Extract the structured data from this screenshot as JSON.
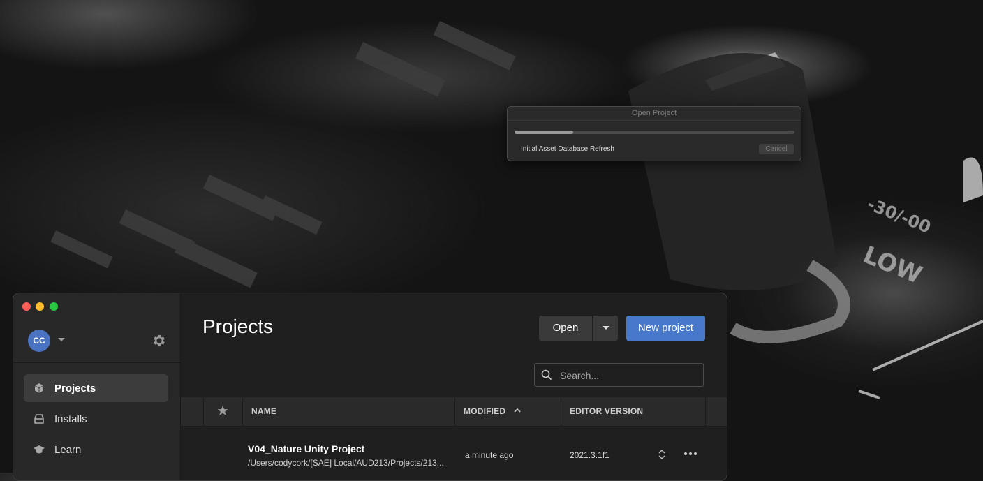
{
  "background": {
    "labels": [
      "LOW",
      "-30/-00"
    ]
  },
  "dialog": {
    "title": "Open Project",
    "status": "Initial Asset Database Refresh",
    "cancel_label": "Cancel",
    "progress": 0.21
  },
  "sidebar": {
    "avatar_initials": "CC",
    "items": [
      {
        "label": "Projects",
        "icon": "cube-icon",
        "active": true
      },
      {
        "label": "Installs",
        "icon": "installs-icon",
        "active": false
      },
      {
        "label": "Learn",
        "icon": "graduation-cap-icon",
        "active": false
      }
    ]
  },
  "main": {
    "title": "Projects",
    "open_label": "Open",
    "new_project_label": "New project",
    "search": {
      "placeholder": "Search..."
    }
  },
  "table": {
    "columns": {
      "name": "NAME",
      "modified": "MODIFIED",
      "editor_version": "EDITOR VERSION"
    },
    "rows": [
      {
        "name": "V04_Nature Unity Project",
        "path": "/Users/codycork/[SAE] Local/AUD213/Projects/213...",
        "modified": "a minute ago",
        "editor_version": "2021.3.1f1"
      }
    ]
  },
  "colors": {
    "accent": "#4778c9",
    "avatar": "#4a73c2",
    "close": "#ff5f57",
    "minimize": "#febc2e",
    "zoom": "#28c840"
  }
}
